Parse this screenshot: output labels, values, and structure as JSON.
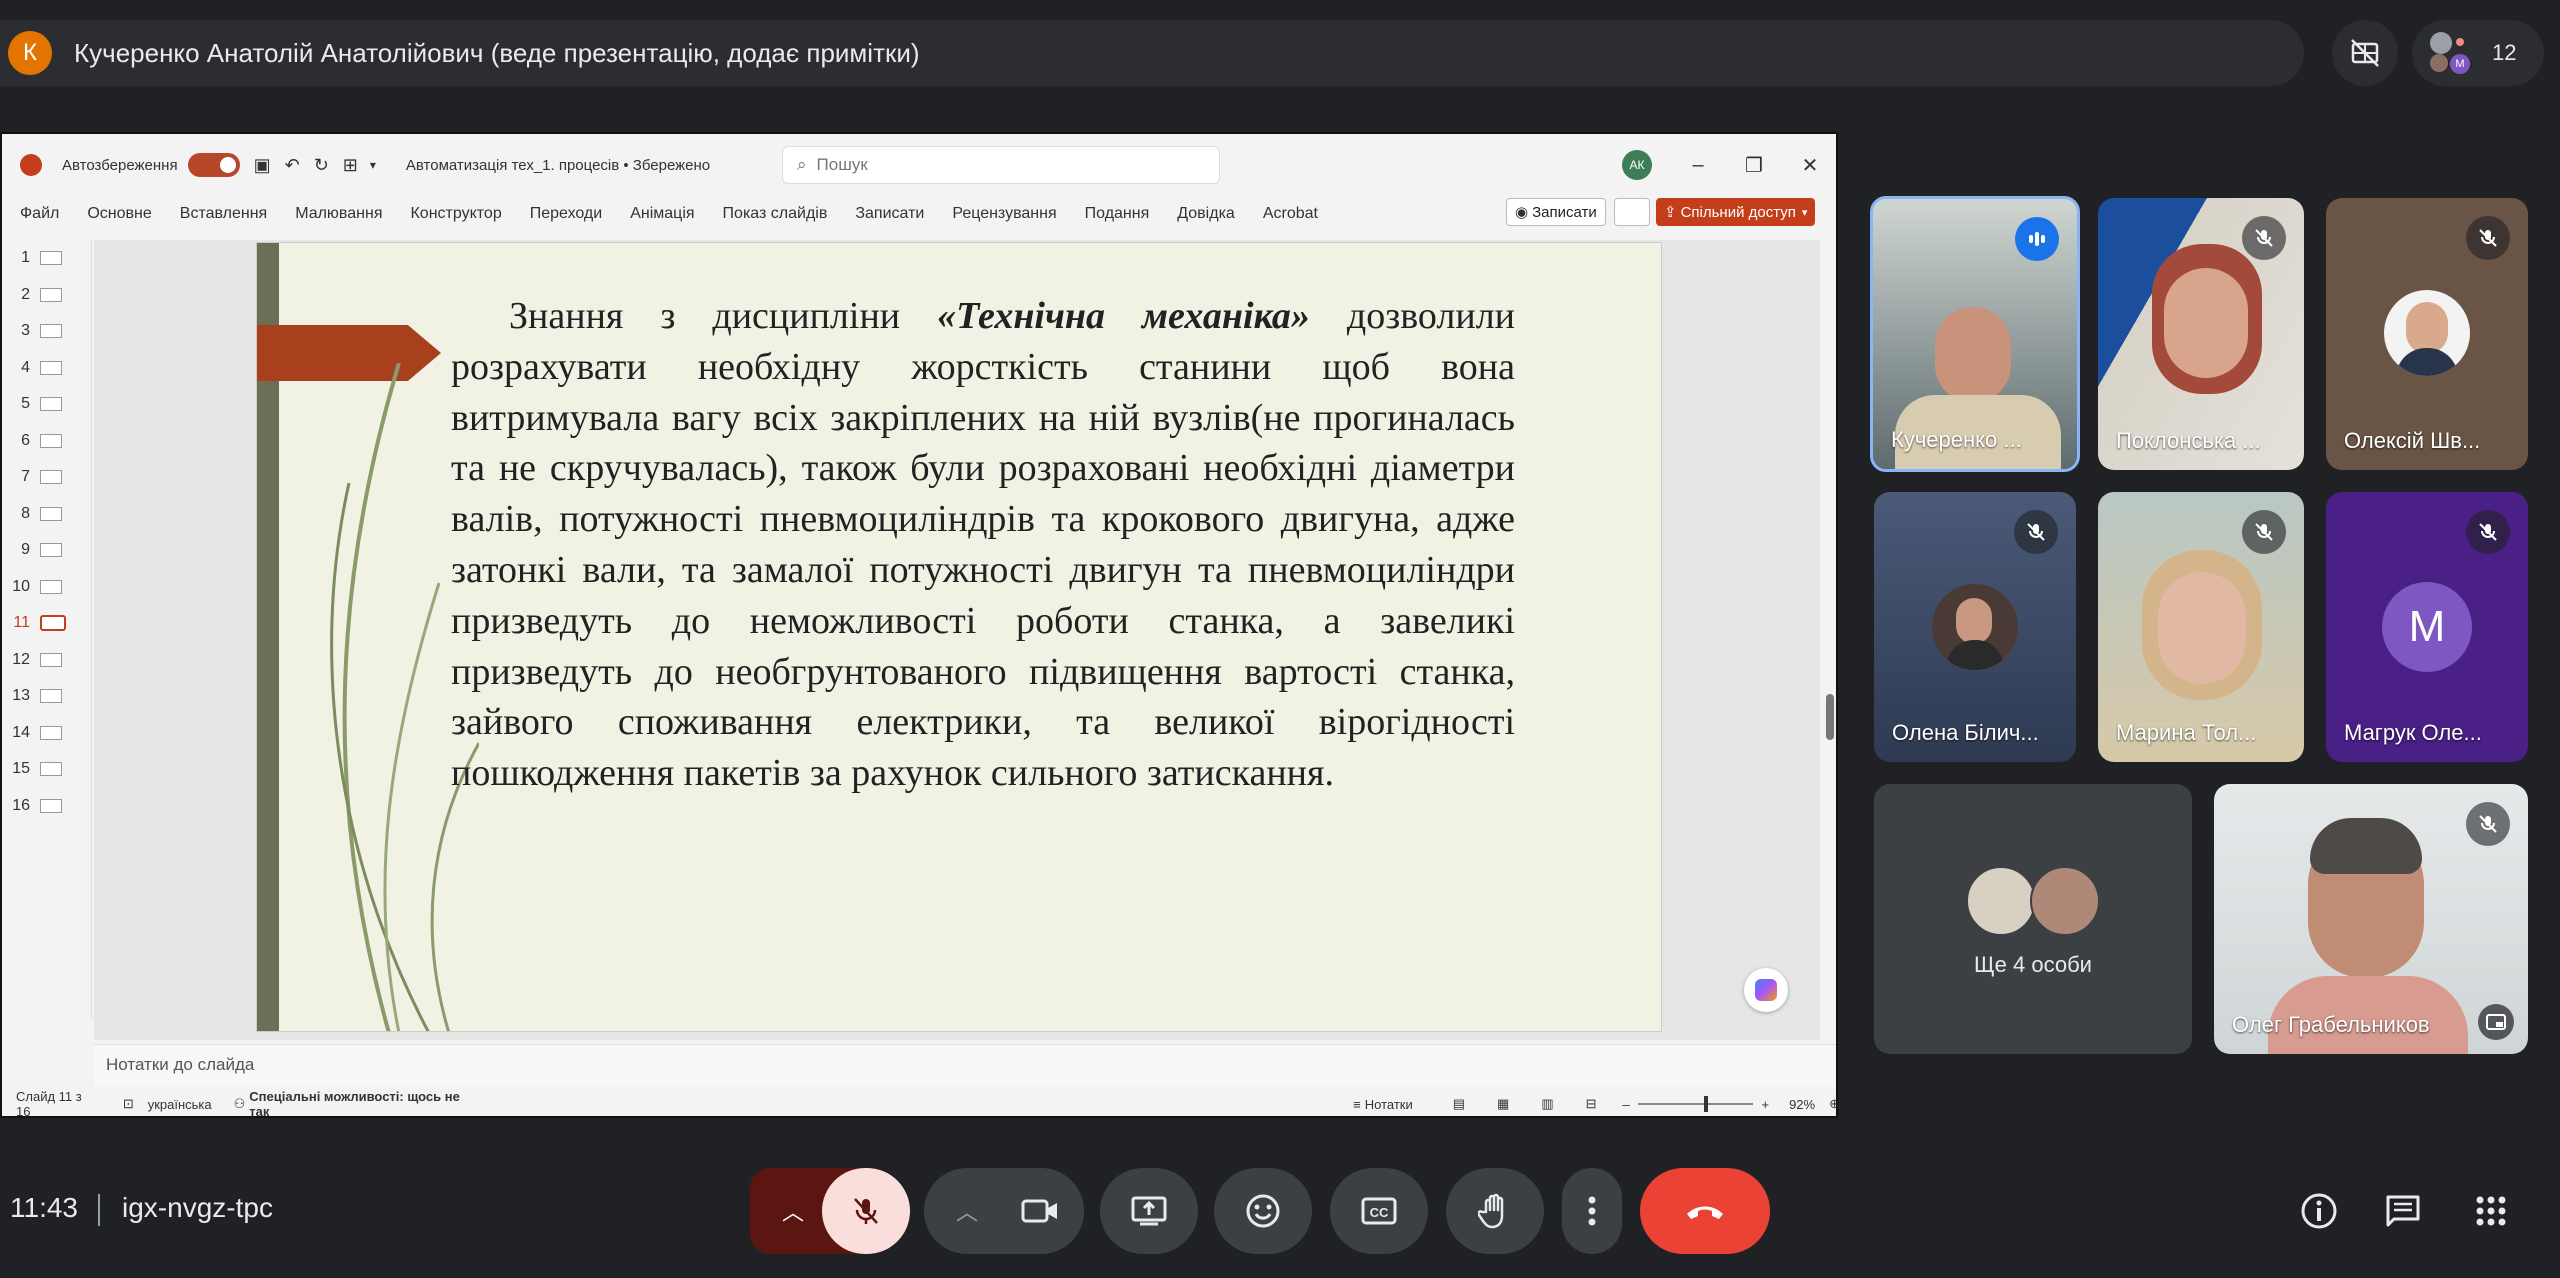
{
  "presenter": {
    "initial": "К",
    "text": "Кучеренко Анатолій Анатолійович (веде презентацію, додає примітки)"
  },
  "people": {
    "count": "12",
    "mini_initial": "M"
  },
  "ppt": {
    "autosave_label": "Автозбереження",
    "doc_title": "Автоматизація тех_1. процесів • Збережено",
    "search_placeholder": "Пошук",
    "user_initials": "АК",
    "menu": [
      "Файл",
      "Основне",
      "Вставлення",
      "Малювання",
      "Конструктор",
      "Переходи",
      "Анімація",
      "Показ слайдів",
      "Записати",
      "Рецензування",
      "Подання",
      "Довідка",
      "Acrobat"
    ],
    "record_label": "Записати",
    "share_label": "Спільний доступ",
    "thumbnails": [
      "1",
      "2",
      "3",
      "4",
      "5",
      "6",
      "7",
      "8",
      "9",
      "10",
      "11",
      "12",
      "13",
      "14",
      "15",
      "16"
    ],
    "active_slide": "11",
    "notes_placeholder": "Нотатки до слайда",
    "status": {
      "slide_counter": "Слайд 11 з 16",
      "language": "українська",
      "accessibility": "Спеціальні можливості: щось не так",
      "notes_label": "Нотатки",
      "zoom": "92%"
    }
  },
  "slide": {
    "text_before": "Знання з дисципліни ",
    "text_em": "«Технічна механіка»",
    "text_after": " дозволили розрахувати необхідну жорсткість станини щоб вона витримувала вагу всіх закріплених на ній вузлів(не прогиналась та не скручувалась), також були розраховані необхідні діаметри валів, потужності пневмоциліндрів та крокового двигуна, адже затонкі вали, та замалої потужності двигун та пневмоциліндри призведуть до неможливості роботи станка,  а завеликі призведуть до необгрунтованого підвищення вартості станка, зайвого споживання електрики, та великої вірогідності пошкодження пакетів за рахунок сильного затискання."
  },
  "participants": [
    {
      "name": "Кучеренко ...",
      "state": "speaking"
    },
    {
      "name": "Поклонська ...",
      "state": "muted"
    },
    {
      "name": "Олексій Шв...",
      "state": "muted"
    },
    {
      "name": "Олена Білич...",
      "state": "muted"
    },
    {
      "name": "Марина Тол...",
      "state": "muted"
    },
    {
      "name": "Магрук Оле...",
      "state": "muted",
      "initial": "М"
    },
    {
      "name": "Олег Грабельников",
      "state": "muted"
    }
  ],
  "more_people": {
    "label": "Ще 4 особи"
  },
  "meeting": {
    "time": "11:43",
    "code": "igx-nvgz-tpc"
  },
  "colors": {
    "end_call": "#ea4335",
    "speaking": "#1a73e8",
    "ppt_accent": "#c43e1c"
  }
}
